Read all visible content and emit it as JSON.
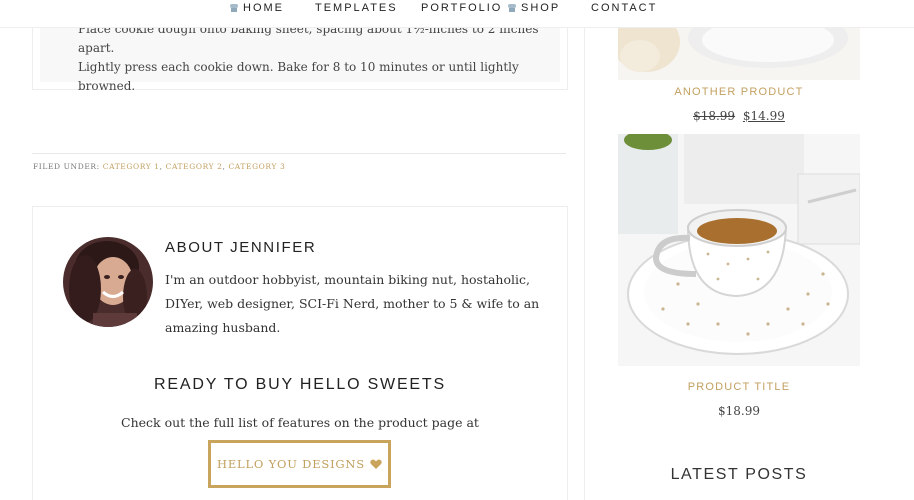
{
  "nav": {
    "items": [
      {
        "label": "HOME",
        "icon": "cupcake-icon"
      },
      {
        "label": "TEMPLATES"
      },
      {
        "label": "PORTFOLIO"
      },
      {
        "label": "SHOP",
        "icon": "cupcake-icon"
      },
      {
        "label": "CONTACT"
      }
    ]
  },
  "recipe": {
    "lines": [
      "Place cookie dough onto baking sheet, spacing about 1½-inches to 2 inches apart.",
      "Lightly press each cookie down. Bake for 8 to 10 minutes or until lightly browned."
    ]
  },
  "entry_footer": {
    "prefix": "FILED UNDER:",
    "categories": [
      "CATEGORY 1",
      "CATEGORY 2",
      "CATEGORY 3"
    ]
  },
  "author": {
    "title": "ABOUT JENNIFER",
    "bio": "I'm an outdoor hobbyist, mountain biking nut, hostaholic, DIYer, web designer, SCI-Fi Nerd, mother to 5 & wife to an amazing husband."
  },
  "cta": {
    "title": "READY TO BUY HELLO SWEETS",
    "text": "Check out the full list of features on the product page at",
    "button_label": "HELLO YOU DESIGNS"
  },
  "sidebar": {
    "products": [
      {
        "title": "ANOTHER PRODUCT",
        "old_price": "$18.99",
        "price": "$14.99"
      },
      {
        "title": "PRODUCT TITLE",
        "price": "$18.99"
      }
    ],
    "latest_posts_title": "LATEST POSTS"
  },
  "colors": {
    "accent": "#c2a060",
    "button_border": "#c9a45c",
    "text": "#333333"
  }
}
